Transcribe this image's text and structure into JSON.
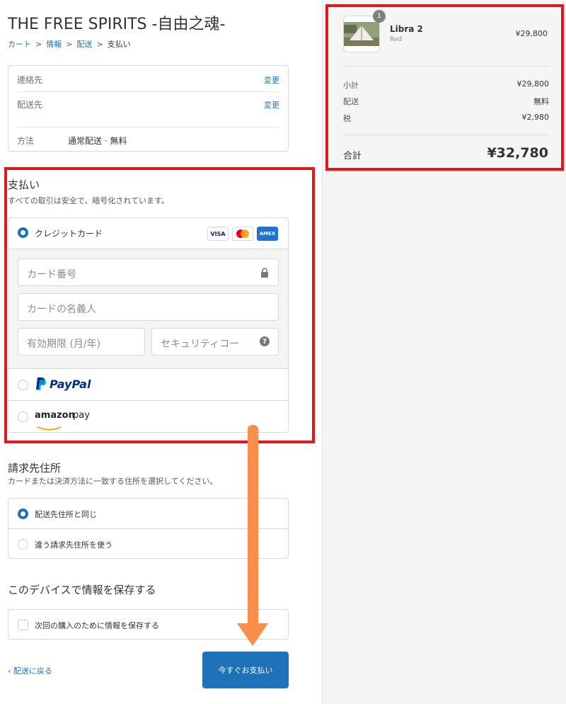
{
  "store": {
    "title": "THE FREE SPIRITS -自由之魂-"
  },
  "breadcrumb": {
    "cart": "カート",
    "info": "情報",
    "shipping": "配送",
    "payment": "支払い",
    "sep": ">"
  },
  "review": {
    "contact_label": "連絡先",
    "contact_change": "変更",
    "shipto_label": "配送先",
    "shipto_change": "変更",
    "method_label": "方法",
    "method_value": "通常配送 · 無料"
  },
  "payment": {
    "title": "支払い",
    "subtitle": "すべての取引は安全で、暗号化されています。",
    "credit_label": "クレジットカード",
    "card_logos": [
      "VISA",
      "MC",
      "AMEX"
    ],
    "card_number_placeholder": "カード番号",
    "name_placeholder": "カードの名義人",
    "expiry_placeholder": "有効期限 (月/年)",
    "cvv_placeholder": "セキュリティコー",
    "paypal_label": "PayPal",
    "amazon_label_a": "amazon",
    "amazon_label_b": "pay"
  },
  "billing": {
    "title": "請求先住所",
    "subtitle": "カードまたは決済方法に一致する住所を選択してください。",
    "same_label": "配送先住所と同じ",
    "diff_label": "違う請求先住所を使う"
  },
  "save": {
    "title": "このデバイスで情報を保存する",
    "checkbox_label": "次回の購入のために情報を保存する"
  },
  "footer": {
    "back_label": "‹ 配送に戻る",
    "pay_label": "今すぐお支払い"
  },
  "summary": {
    "badge": "1",
    "product_name": "Libra 2",
    "product_variant": "Red",
    "product_price": "¥29,800",
    "subtotal_label": "小計",
    "subtotal_value": "¥29,800",
    "shipping_label": "配送",
    "shipping_value": "無料",
    "tax_label": "税",
    "tax_value": "¥2,980",
    "total_label": "合計",
    "total_value": "¥32,780"
  },
  "colors": {
    "accent": "#1f72b8",
    "highlight": "#e3161e",
    "arrow": "#fb8e4c"
  }
}
